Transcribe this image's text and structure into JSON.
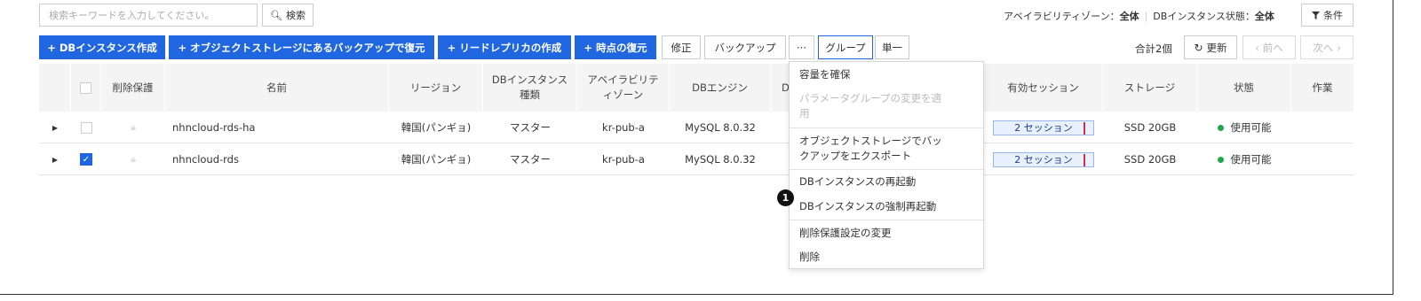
{
  "search": {
    "placeholder": "検索キーワードを入力してください。",
    "button_label": "検索"
  },
  "filter_summary": {
    "zone_label": "アベイラビリティゾーン：",
    "zone_value": "全体",
    "state_label": "DBインスタンス状態：",
    "state_value": "全体",
    "condition_button": "条件"
  },
  "toolbar": {
    "create_instance": "DBインスタンス作成",
    "restore_from_storage": "オブジェクトストレージにあるバックアップで復元",
    "create_read_replica": "リードレプリカの作成",
    "point_in_time_restore": "時点の復元",
    "modify": "修正",
    "backup": "バックアップ",
    "more": "···",
    "group": "グループ",
    "single": "単一",
    "total": "合計2個",
    "refresh": "更新",
    "prev": "前へ",
    "next": "次へ"
  },
  "table": {
    "headers": {
      "delete_protection": "削除保護",
      "name": "名前",
      "region": "リージョン",
      "instance_type": "DBインスタンス種類",
      "availability_zone": "アベイラビリティゾーン",
      "db_engine": "DBエンジン",
      "truncated": "D",
      "active_sessions": "有効セッション",
      "storage": "ストレージ",
      "status": "状態",
      "actions": "作業"
    },
    "rows": [
      {
        "checked": false,
        "name": "nhncloud-rds-ha",
        "region": "韓国(パンギョ)",
        "type": "マスター",
        "zone": "kr-pub-a",
        "engine": "MySQL 8.0.32",
        "sessions": "2 セッション",
        "storage": "SSD 20GB",
        "status": "使用可能"
      },
      {
        "checked": true,
        "name": "nhncloud-rds",
        "region": "韓国(パンギョ)",
        "type": "マスター",
        "zone": "kr-pub-a",
        "engine": "MySQL 8.0.32",
        "sessions": "2 セッション",
        "storage": "SSD 20GB",
        "status": "使用可能"
      }
    ]
  },
  "dropdown": {
    "items": [
      {
        "label": "容量を確保",
        "disabled": false
      },
      {
        "label": "パラメータグループの変更を適用",
        "disabled": true
      },
      {
        "label": "オブジェクトストレージでバックアップをエクスポート",
        "disabled": false
      },
      {
        "label": "DBインスタンスの再起動",
        "disabled": false
      },
      {
        "label": "DBインスタンスの強制再起動",
        "disabled": false
      },
      {
        "label": "削除保護設定の変更",
        "disabled": false
      },
      {
        "label": "削除",
        "disabled": false
      }
    ]
  },
  "marker": {
    "label": "1"
  },
  "colors": {
    "primary": "#1f66e0",
    "status_ok": "#1fa84a",
    "session_bar": "#e8f0fc",
    "session_accent": "#d0304b"
  },
  "icons": {
    "search": "search-icon",
    "filter": "filter-icon",
    "refresh": "refresh-icon",
    "lock": "lock-icon",
    "expand": "caret-right-icon",
    "plus": "plus-icon"
  }
}
